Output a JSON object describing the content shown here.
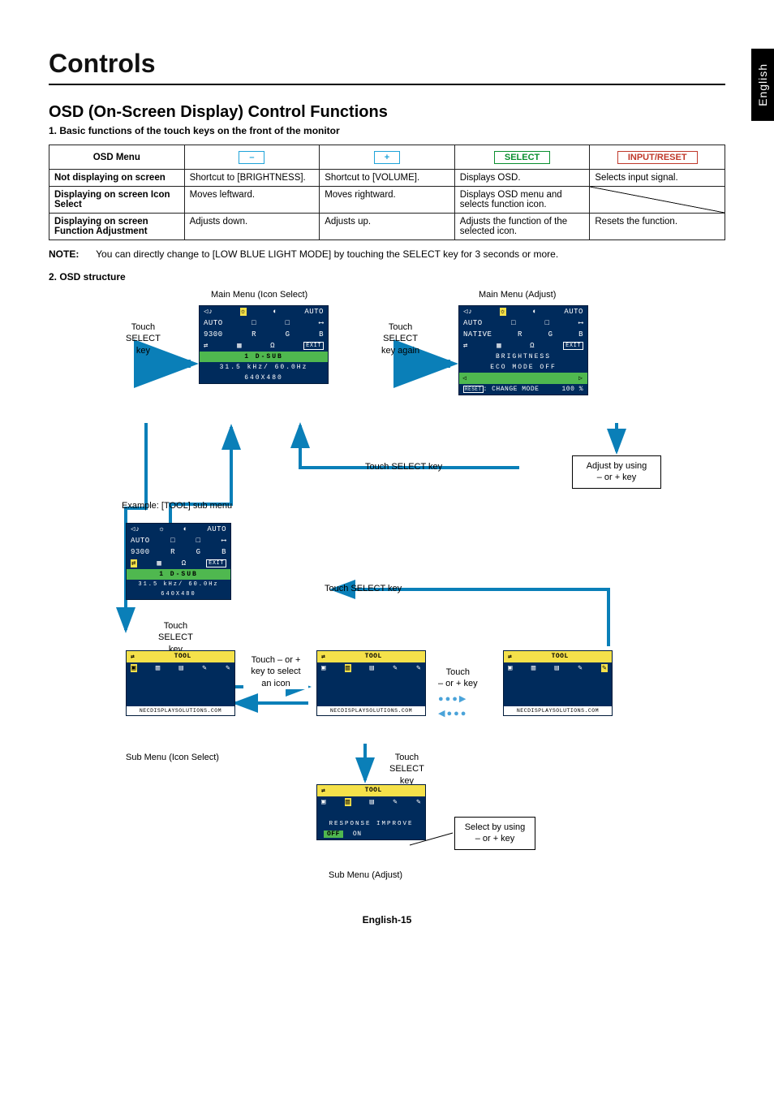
{
  "lang_tab": "English",
  "title": "Controls",
  "section_title": "OSD (On-Screen Display) Control Functions",
  "sub1": "1. Basic functions of the touch keys on the front of the monitor",
  "table": {
    "headers": {
      "menu": "OSD Menu",
      "minus": "–",
      "plus": "+",
      "select": "SELECT",
      "reset": "INPUT/RESET"
    },
    "rows": [
      {
        "menu": "Not displaying on screen",
        "minus": "Shortcut to [BRIGHTNESS].",
        "plus": "Shortcut to [VOLUME].",
        "select": "Displays OSD.",
        "reset": "Selects input signal."
      },
      {
        "menu": "Displaying on screen Icon Select",
        "minus": "Moves leftward.",
        "plus": "Moves rightward.",
        "select": "Displays OSD menu and selects function icon.",
        "reset": ""
      },
      {
        "menu": "Displaying on screen Function Adjustment",
        "minus": "Adjusts down.",
        "plus": "Adjusts up.",
        "select": "Adjusts the function of the selected icon.",
        "reset": "Resets the function."
      }
    ]
  },
  "note_label": "NOTE:",
  "note_text": "You can directly change to [LOW BLUE LIGHT MODE] by touching the SELECT key for 3 seconds or more.",
  "sub2": "2. OSD structure",
  "diagram": {
    "main_icon_title": "Main Menu (Icon Select)",
    "main_adjust_title": "Main Menu (Adjust)",
    "touch_select": "Touch\nSELECT\nkey",
    "touch_select_again": "Touch\nSELECT\nkey again",
    "touch_select_line": "Touch SELECT key",
    "adjust_box": "Adjust by using\n– or + key",
    "example_label": "Example: [TOOL] sub menu",
    "touch_pm_box": "Touch – or +\nkey to select\nan icon",
    "touch_pm_label": "Touch\n– or + key",
    "sub_icon_title": "Sub Menu (Icon Select)",
    "sub_adjust_title": "Sub Menu (Adjust)",
    "select_box": "Select by using\n– or + key",
    "panel_main": {
      "icons_r1": [
        "◁♪",
        "☼",
        "◐",
        "AUTO"
      ],
      "icons_r2": [
        "AUTO",
        "□",
        "□",
        "⟷"
      ],
      "icons_r3": [
        "9300",
        "R",
        "G",
        "B"
      ],
      "icons_r4": [
        "⇄",
        "▦",
        "Ω",
        "EXIT"
      ],
      "status_input": "1  D-SUB",
      "status_freq": "31.5 kHz/  60.0Hz",
      "status_res": "640X480"
    },
    "panel_adjust": {
      "brightness": "BRIGHTNESS",
      "eco": "ECO MODE OFF",
      "change": ": CHANGE MODE",
      "reset_lbl": "RESET",
      "value": "100 %"
    },
    "panel_tool": {
      "header": "TOOL",
      "icons": [
        "▣",
        "▥",
        "▤",
        "✎",
        "✎"
      ],
      "url": "NECDISPLAYSOLUTIONS.COM"
    },
    "panel_response": {
      "header": "TOOL",
      "label": "RESPONSE IMPROVE",
      "off": "OFF",
      "on": "ON"
    },
    "native_label": "NATIVE"
  },
  "page_num": "English-15"
}
